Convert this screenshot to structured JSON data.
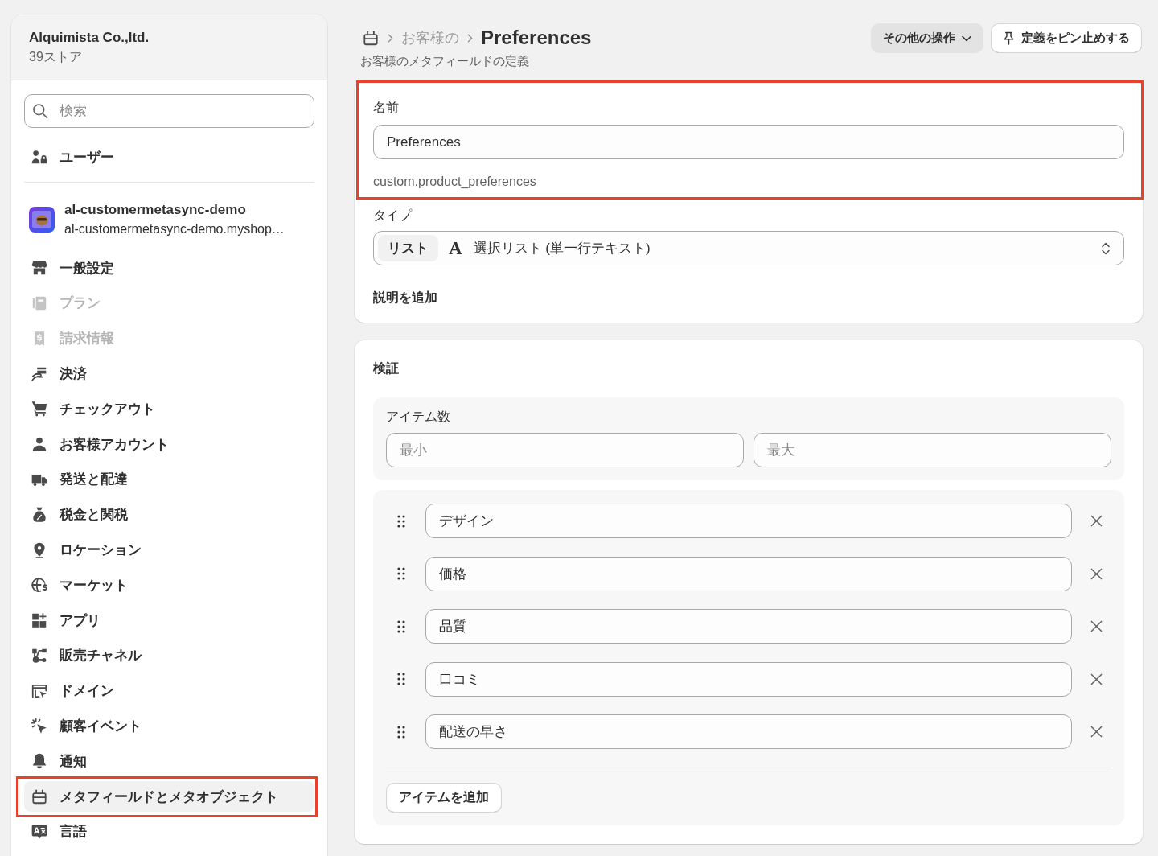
{
  "sidebar": {
    "organization": {
      "name": "Alquimista Co.,ltd.",
      "store_count": "39ストア"
    },
    "search": {
      "placeholder": "検索"
    },
    "users_item": {
      "label": "ユーザー"
    },
    "store": {
      "name": "al-customermetasync-demo",
      "domain": "al-customermetasync-demo.myshop…"
    },
    "items": [
      {
        "label": "一般設定",
        "selected": false,
        "disabled": false,
        "highlighted": false
      },
      {
        "label": "プラン",
        "selected": false,
        "disabled": true,
        "highlighted": false
      },
      {
        "label": "請求情報",
        "selected": false,
        "disabled": true,
        "highlighted": false
      },
      {
        "label": "決済",
        "selected": false,
        "disabled": false,
        "highlighted": false
      },
      {
        "label": "チェックアウト",
        "selected": false,
        "disabled": false,
        "highlighted": false
      },
      {
        "label": "お客様アカウント",
        "selected": false,
        "disabled": false,
        "highlighted": false
      },
      {
        "label": "発送と配達",
        "selected": false,
        "disabled": false,
        "highlighted": false
      },
      {
        "label": "税金と関税",
        "selected": false,
        "disabled": false,
        "highlighted": false
      },
      {
        "label": "ロケーション",
        "selected": false,
        "disabled": false,
        "highlighted": false
      },
      {
        "label": "マーケット",
        "selected": false,
        "disabled": false,
        "highlighted": false
      },
      {
        "label": "アプリ",
        "selected": false,
        "disabled": false,
        "highlighted": false
      },
      {
        "label": "販売チャネル",
        "selected": false,
        "disabled": false,
        "highlighted": false
      },
      {
        "label": "ドメイン",
        "selected": false,
        "disabled": false,
        "highlighted": false
      },
      {
        "label": "顧客イベント",
        "selected": false,
        "disabled": false,
        "highlighted": false
      },
      {
        "label": "通知",
        "selected": false,
        "disabled": false,
        "highlighted": false
      },
      {
        "label": "メタフィールドとメタオブジェクト",
        "selected": true,
        "disabled": false,
        "highlighted": true
      },
      {
        "label": "言語",
        "selected": false,
        "disabled": false,
        "highlighted": false
      }
    ]
  },
  "header": {
    "breadcrumb": [
      "お客様の"
    ],
    "title": "Preferences",
    "subtitle": "お客様のメタフィールドの定義",
    "actions": [
      {
        "kind": "menu",
        "label": "その他の操作"
      },
      {
        "kind": "pin",
        "label": "定義をピン止めする"
      }
    ]
  },
  "definition_card": {
    "highlighted": true,
    "name_label": "名前",
    "name_value": "Preferences",
    "key": "custom.product_preferences",
    "type_label": "タイプ",
    "type_tag": "リスト",
    "type_icon": "A",
    "type_value": "選択リスト (単一行テキスト)",
    "add_description": "説明を追加"
  },
  "validation_card": {
    "title": "検証",
    "item_count": {
      "label": "アイテム数",
      "min_placeholder": "最小",
      "max_placeholder": "最大"
    },
    "choices": [
      {
        "value": "デザイン"
      },
      {
        "value": "価格"
      },
      {
        "value": "品質"
      },
      {
        "value": "口コミ"
      },
      {
        "value": "配送の早さ"
      }
    ],
    "add_button": "アイテムを追加"
  }
}
